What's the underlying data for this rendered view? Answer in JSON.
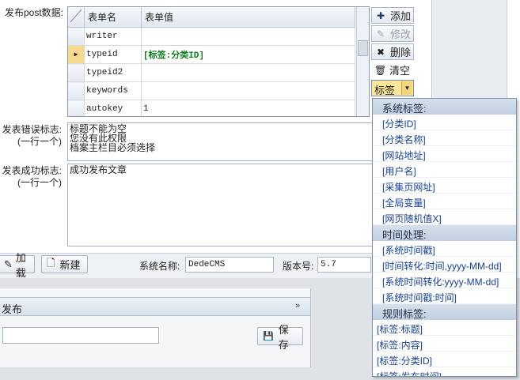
{
  "labels": {
    "post_data": "发布post数据:",
    "error_flag": "发表错误标志:",
    "error_hint": "(一行一个)",
    "success_flag": "发表成功标志:",
    "success_hint": "(一行一个)"
  },
  "grid": {
    "columns": [
      "表单名",
      "表单值"
    ],
    "rows": [
      {
        "name": "writer",
        "value": "",
        "current": false
      },
      {
        "name": "typeid",
        "value": "[标签:分类ID]",
        "current": true
      },
      {
        "name": "typeid2",
        "value": "",
        "current": false
      },
      {
        "name": "keywords",
        "value": "",
        "current": false
      },
      {
        "name": "autokey",
        "value": "1",
        "current": false
      }
    ]
  },
  "side_buttons": {
    "add": "添加",
    "edit": "修改",
    "delete": "删除",
    "clear": "清空"
  },
  "error_text": "标题不能为空\n您没有此权限\n档案主栏目必须选择",
  "success_text": "成功发布文章",
  "toolbar": {
    "load": "加载",
    "new": "新建",
    "system_name_label": "系统名称:",
    "system_name_value": "DedeCMS",
    "version_label": "版本号:",
    "version_value": "5.7"
  },
  "lower": {
    "publish_title": "发布",
    "save": "保存"
  },
  "tag_select": {
    "value": "标签"
  },
  "menu": [
    {
      "type": "head",
      "text": "系统标签:"
    },
    {
      "type": "item",
      "text": "[分类ID]"
    },
    {
      "type": "item",
      "text": "[分类名称]"
    },
    {
      "type": "item",
      "text": "[网站地址]"
    },
    {
      "type": "item",
      "text": "[用户名]"
    },
    {
      "type": "item",
      "text": "[采集页网址]"
    },
    {
      "type": "item",
      "text": "[全局变量]"
    },
    {
      "type": "item",
      "text": "[网页随机值X]"
    },
    {
      "type": "head",
      "text": "时间处理:"
    },
    {
      "type": "item",
      "text": "[系统时间戳]"
    },
    {
      "type": "item",
      "text": "[时间转化:时间,yyyy-MM-dd]"
    },
    {
      "type": "item",
      "text": "[系统时间转化:yyyy-MM-dd]"
    },
    {
      "type": "item",
      "text": "[系统时间戳:时间]"
    },
    {
      "type": "head",
      "text": "规则标签:"
    },
    {
      "type": "flush",
      "text": "[标签:标题]"
    },
    {
      "type": "flush",
      "text": "[标签:内容]"
    },
    {
      "type": "flush",
      "text": "[标签:分类ID]"
    },
    {
      "type": "flush",
      "text": "[标签:发布时间]"
    }
  ]
}
